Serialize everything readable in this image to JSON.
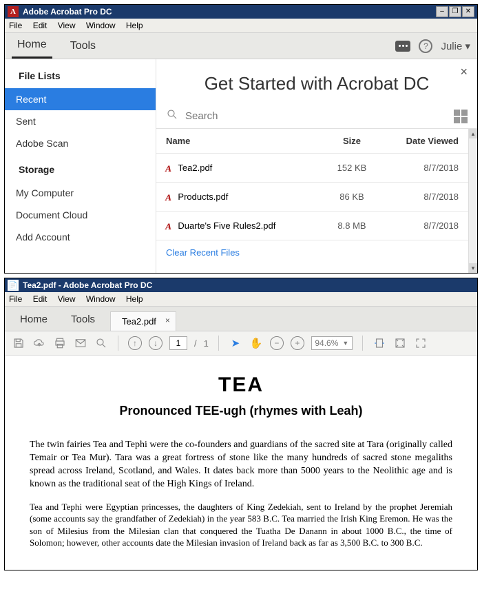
{
  "win1": {
    "title": "Adobe Acrobat Pro DC",
    "app_glyph": "A",
    "menus": [
      "File",
      "Edit",
      "View",
      "Window",
      "Help"
    ],
    "tabs": {
      "home": "Home",
      "tools": "Tools"
    },
    "user": "Julie",
    "close_glyph": "×",
    "sidebar": {
      "file_lists_heading": "File Lists",
      "recent": "Recent",
      "sent": "Sent",
      "adobe_scan": "Adobe Scan",
      "storage_heading": "Storage",
      "my_computer": "My Computer",
      "document_cloud": "Document Cloud",
      "add_account": "Add Account"
    },
    "welcome": "Get Started with Acrobat DC",
    "search_placeholder": "Search",
    "columns": {
      "name": "Name",
      "size": "Size",
      "date": "Date Viewed"
    },
    "rows": [
      {
        "name": "Tea2.pdf",
        "size": "152 KB",
        "date": "8/7/2018"
      },
      {
        "name": "Products.pdf",
        "size": "86 KB",
        "date": "8/7/2018"
      },
      {
        "name": "Duarte's Five Rules2.pdf",
        "size": "8.8 MB",
        "date": "8/7/2018"
      }
    ],
    "clear_link": "Clear Recent Files"
  },
  "win2": {
    "title": "Tea2.pdf - Adobe Acrobat Pro DC",
    "menus": [
      "File",
      "Edit",
      "View",
      "Window",
      "Help"
    ],
    "tabs": {
      "home": "Home",
      "tools": "Tools",
      "file": "Tea2.pdf"
    },
    "page": {
      "current": "1",
      "sep": "/",
      "total": "1"
    },
    "zoom": "94.6%",
    "doc": {
      "title": "TEA",
      "subtitle": "Pronounced TEE-ugh (rhymes with Leah)",
      "p1": "The twin fairies Tea and Tephi were the co-founders and guardians of the sacred site at Tara (originally called Temair or Tea Mur). Tara was a great fortress of stone like the many hundreds of sacred stone megaliths spread across Ireland, Scotland, and Wales. It dates back more than 5000 years to the Neolithic age and is known as the traditional seat of the High Kings of Ireland.",
      "p2": "Tea and Tephi were Egyptian princesses, the daughters of King Zedekiah, sent to Ireland by the prophet Jeremiah (some accounts say the grandfather of Zedekiah) in the year 583 B.C. Tea married the Irish King Eremon. He was the son of Milesius from the Milesian clan that conquered the Tuatha De Danann in about 1000 B.C., the time of Solomon; however, other accounts date the Milesian invasion of Ireland back as far as 3,500 B.C. to 300 B.C."
    }
  }
}
